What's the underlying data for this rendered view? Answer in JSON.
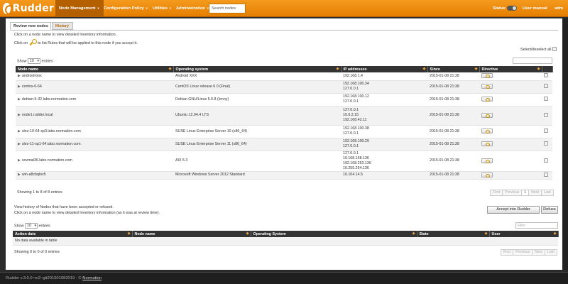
{
  "app": {
    "logo_text": "Rudder",
    "search_placeholder": "Search nodes"
  },
  "nav": {
    "items": [
      {
        "label": "Node Management",
        "active": true
      },
      {
        "label": "Configuration Policy",
        "active": false
      },
      {
        "label": "Utilities",
        "active": false
      },
      {
        "label": "Administration",
        "active": false
      }
    ],
    "status_label": "Status",
    "user_manual": "User manual",
    "user": "adm"
  },
  "tabs": [
    {
      "label": "Review new nodes",
      "active": true
    },
    {
      "label": "History",
      "active": false
    }
  ],
  "pending": {
    "info_line1": "Click on a node name to view detailed Inventory information.",
    "info_line2_pre": "Click on",
    "info_line2_post": "to list Rules that will be applied to this node if you accept it.",
    "select_all": "Select/deselect all",
    "show": "Show",
    "entries": "entries",
    "page_size": "10",
    "columns": [
      "Node name",
      "Operating system",
      "IP addresses",
      "Since",
      "Directive"
    ],
    "rows": [
      {
        "name": "android-box",
        "os": "Android XXX",
        "ips": [
          "192.168.1.4"
        ],
        "since": "2015-01-08 21:38"
      },
      {
        "name": "centos-6-64",
        "os": "CentOS Linux release 6.0 (Final)",
        "ips": [
          "192.168.100.34",
          "127.0.0.1"
        ],
        "since": "2015-01-08 21:38"
      },
      {
        "name": "debian-5-32.labo.normation.com",
        "os": "Debian GNU/Linux 5.0.8 (lenny)",
        "ips": [
          "192.168.100.12",
          "127.0.0.1"
        ],
        "since": "2015-01-08 21:38"
      },
      {
        "name": "node1.rudder.local",
        "os": "Ubuntu 12.04.4 LTS",
        "ips": [
          "127.0.0.1",
          "10.0.2.15",
          "192.168.42.11"
        ],
        "since": "2015-01-08 21:38"
      },
      {
        "name": "sles-10-64-sp3.labo.normation.com",
        "os": "SUSE Linux Enterprise Server 10 (x86_64)",
        "ips": [
          "192.168.100.38",
          "127.0.0.1"
        ],
        "since": "2015-01-08 21:38"
      },
      {
        "name": "sles-11-sp1-64.labo.normation.com",
        "os": "SUSE Linux Enterprise Server 11 (x86_64)",
        "ips": [
          "192.168.100.29",
          "127.0.0.1"
        ],
        "since": "2015-01-08 21:38"
      },
      {
        "name": "sovmat36.labo.normation.com",
        "os": "AIX 5.3",
        "ips": [
          "127.0.0.1",
          "10.168.168.136",
          "192.168.253.136",
          "10.255.254.136"
        ],
        "since": "2015-01-08 21:38"
      },
      {
        "name": "win-a8cbqlov5",
        "os": "Microsoft Windows Server 2012 Standard",
        "ips": [
          "10.104.14.5"
        ],
        "since": "2015-01-08 21:38"
      }
    ],
    "count_text": "Showing 1 to 8 of 8 entries",
    "pager": [
      "First",
      "Previous",
      "1",
      "Next",
      "Last"
    ]
  },
  "history": {
    "info_line1": "View history of Nodes that have been accepted or refused.",
    "info_line2": "Click on a node name to view detailed Inventory information (as it was at review time).",
    "accept_button": "Accept into Rudder",
    "refuse_button": "Refuse",
    "show": "Show",
    "entries": "entries",
    "page_size": "10",
    "filter_placeholder": "Filter",
    "columns": [
      "Action date",
      "Node name",
      "Operating System",
      "State",
      "User"
    ],
    "empty_text": "No data available in table",
    "count_text": "Showing 0 to 0 of 0 entries",
    "pager": [
      "First",
      "Previous",
      "Next",
      "Last"
    ]
  },
  "footer": {
    "text": "Rudder v.3.0.0~rc2~git201501082019 - ©",
    "link": "Normation"
  },
  "colors": {
    "brand_orange": "#e47e00",
    "header_dark": "#333333"
  }
}
